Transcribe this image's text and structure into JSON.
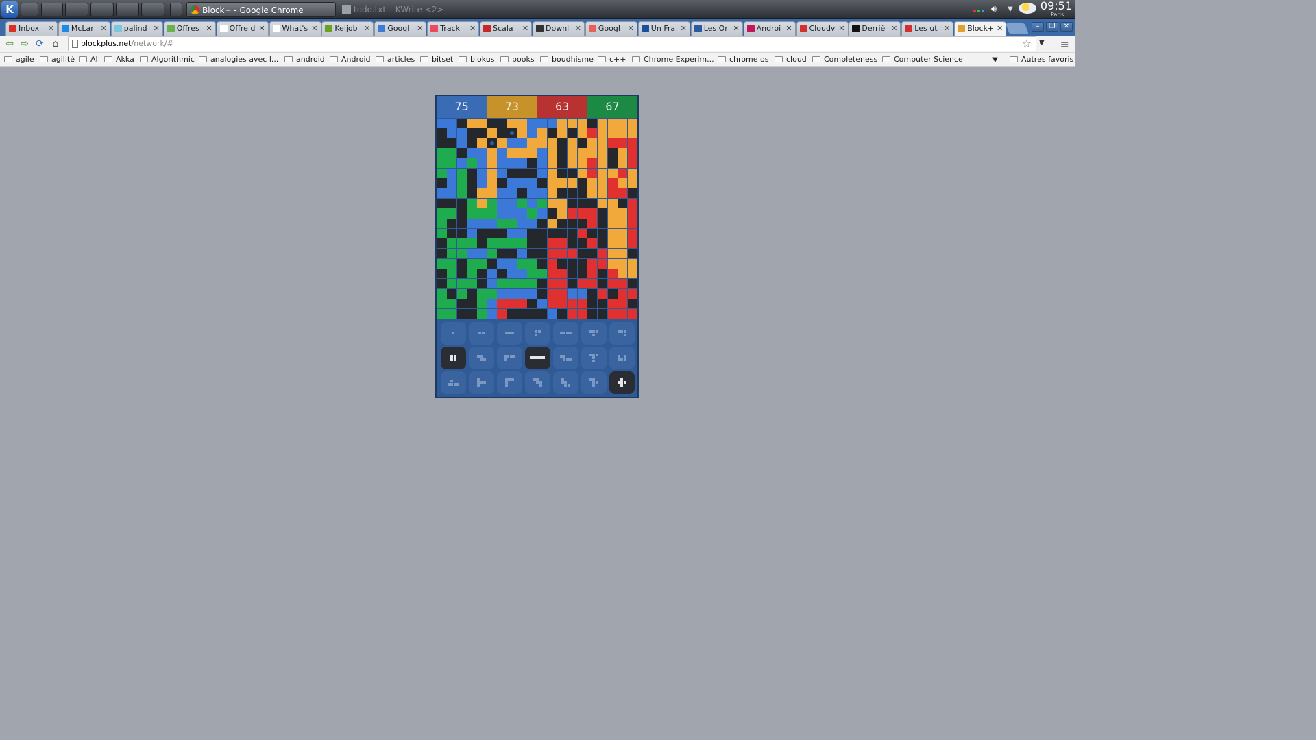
{
  "taskbar": {
    "tasks": [
      {
        "label": "Block+ - Google Chrome",
        "state": "active"
      },
      {
        "label": "todo.txt – KWrite <2>",
        "state": "inactive"
      }
    ],
    "clock": "09:51",
    "city": "Paris"
  },
  "tabs": [
    {
      "label": "Inbox",
      "icon": "gmail-icon",
      "color": "#d93025"
    },
    {
      "label": "McLar",
      "icon": "drive-icon",
      "color": "#1e88e5"
    },
    {
      "label": "palind",
      "icon": "docs-icon",
      "color": "#7ec6e0"
    },
    {
      "label": "Offres",
      "icon": "offres-icon",
      "color": "#6ab04c"
    },
    {
      "label": "Offre d",
      "icon": "page-icon",
      "color": "#ffffff"
    },
    {
      "label": "What's",
      "icon": "page-icon",
      "color": "#ffffff"
    },
    {
      "label": "Keljob",
      "icon": "keljob-icon",
      "color": "#6aa121"
    },
    {
      "label": "Googl",
      "icon": "calendar-icon",
      "color": "#3e7bd6"
    },
    {
      "label": "Track",
      "icon": "track-icon",
      "color": "#e84a5f"
    },
    {
      "label": "Scala",
      "icon": "scala-icon",
      "color": "#c62828"
    },
    {
      "label": "Downl",
      "icon": "download-icon",
      "color": "#333333"
    },
    {
      "label": "Googl",
      "icon": "google-icon",
      "color": "#e9605a"
    },
    {
      "label": "Un Fra",
      "icon": "unfra-icon",
      "color": "#1b4f9c"
    },
    {
      "label": "Les Or",
      "icon": "flag-icon",
      "color": "#2c5aa0"
    },
    {
      "label": "Androi",
      "icon": "android-icon",
      "color": "#c2185b"
    },
    {
      "label": "Cloudv",
      "icon": "cloud-icon",
      "color": "#d32f2f"
    },
    {
      "label": "Derriè",
      "icon": "derriere-icon",
      "color": "#111111"
    },
    {
      "label": "Les ut",
      "icon": "01net-icon",
      "color": "#d32f2f"
    },
    {
      "label": "Block+",
      "icon": "blockplus-icon",
      "color": "#e0a030"
    }
  ],
  "toolbar": {
    "url_host": "blockplus.net",
    "url_path": "/network/#"
  },
  "bookmarks": [
    "agile",
    "agilité",
    "AI",
    "Akka",
    "Algorithmic",
    "analogies avec l...",
    "android",
    "Android",
    "articles",
    "bitset",
    "blokus",
    "books",
    "boudhisme",
    "c++",
    "Chrome Experim...",
    "chrome os",
    "cloud",
    "Completeness",
    "Computer Science"
  ],
  "other_bookmarks": "Autres favoris",
  "game": {
    "scores": [
      {
        "value": "75",
        "color": "#3a6cb5"
      },
      {
        "value": "73",
        "color": "#c8922b"
      },
      {
        "value": "63",
        "color": "#b83232"
      },
      {
        "value": "67",
        "color": "#1c8a45"
      }
    ],
    "palette": {
      "B": "#3b78d8",
      "Y": "#f2a93b",
      "R": "#e0302f",
      "G": "#1fac4f",
      "D": "#24272c"
    },
    "board": [
      "BBDYYDDYYBBBYYYDYYYY",
      "DBBDDYDDYBYDYDYRYYYY",
      "DDBDYDYBBYYYDYDYYRRR",
      "GGDBBYBYYYBYDYYYYDYR",
      "GGBGBYBBBDBYDYYRYDYR",
      "GBGDBYBDDDBYDDYRYYRY",
      "DBGDBYDBBBDYYYDYYRYY",
      "BBGDYYBBDBBYDDDYYRRD",
      "DDDGYGBBGBGYYDDDYYDR",
      "GGDGGGBBBGBDYRRRDYYR",
      "GDDBBBGGBBDYDDDRDYYR",
      "GDDBDDDBBDDDDDRDDYYR",
      "DGGGDGGGGDDRRDDRDYYR",
      "DGGBBGDDBDDRRRDDRYY",
      "GGDGGDBBGGDRDDDRRYYY",
      "DGDGDBDBBGGRRDDRDRYY",
      "DGGGDBGGGGDRRDRRDRRD",
      "GDGDGGBBBBDRRBBDRDRR",
      "GGDDGBRRRDBRRRRDDRR",
      "GGDDGBRDDDDBDRRDDRRR"
    ],
    "marks": [
      [
        1,
        7
      ],
      [
        2,
        5
      ]
    ],
    "pieces": [
      {
        "cells": [
          [
            0,
            0
          ]
        ],
        "available": false
      },
      {
        "cells": [
          [
            0,
            0
          ],
          [
            1,
            0
          ]
        ],
        "available": false
      },
      {
        "cells": [
          [
            0,
            0
          ],
          [
            1,
            0
          ],
          [
            2,
            0
          ]
        ],
        "available": false
      },
      {
        "cells": [
          [
            0,
            0
          ],
          [
            1,
            0
          ],
          [
            0,
            1
          ]
        ],
        "available": false
      },
      {
        "cells": [
          [
            0,
            0
          ],
          [
            1,
            0
          ],
          [
            2,
            0
          ],
          [
            3,
            0
          ]
        ],
        "available": false
      },
      {
        "cells": [
          [
            0,
            0
          ],
          [
            1,
            0
          ],
          [
            2,
            0
          ],
          [
            1,
            1
          ]
        ],
        "available": false
      },
      {
        "cells": [
          [
            0,
            0
          ],
          [
            1,
            0
          ],
          [
            2,
            0
          ],
          [
            2,
            1
          ]
        ],
        "available": false
      },
      {
        "cells": [
          [
            0,
            0
          ],
          [
            1,
            0
          ],
          [
            0,
            1
          ],
          [
            1,
            1
          ]
        ],
        "available": true
      },
      {
        "cells": [
          [
            0,
            0
          ],
          [
            1,
            0
          ],
          [
            1,
            1
          ],
          [
            2,
            1
          ]
        ],
        "available": false
      },
      {
        "cells": [
          [
            0,
            0
          ],
          [
            1,
            0
          ],
          [
            2,
            0
          ],
          [
            3,
            0
          ],
          [
            0,
            1
          ]
        ],
        "available": false
      },
      {
        "cells": [
          [
            0,
            0
          ],
          [
            1,
            0
          ],
          [
            2,
            0
          ],
          [
            3,
            0
          ],
          [
            4,
            0
          ]
        ],
        "available": true
      },
      {
        "cells": [
          [
            0,
            0
          ],
          [
            1,
            0
          ],
          [
            2,
            1
          ],
          [
            1,
            1
          ],
          [
            3,
            1
          ]
        ],
        "available": false
      },
      {
        "cells": [
          [
            0,
            0
          ],
          [
            1,
            0
          ],
          [
            2,
            0
          ],
          [
            1,
            1
          ],
          [
            1,
            2
          ]
        ],
        "available": false
      },
      {
        "cells": [
          [
            0,
            0
          ],
          [
            2,
            0
          ],
          [
            0,
            1
          ],
          [
            1,
            1
          ],
          [
            2,
            1
          ]
        ],
        "available": false
      },
      {
        "cells": [
          [
            1,
            0
          ],
          [
            0,
            1
          ],
          [
            1,
            1
          ],
          [
            2,
            1
          ],
          [
            3,
            1
          ]
        ],
        "available": false
      },
      {
        "cells": [
          [
            0,
            0
          ],
          [
            0,
            1
          ],
          [
            1,
            1
          ],
          [
            2,
            1
          ],
          [
            0,
            2
          ]
        ],
        "available": false
      },
      {
        "cells": [
          [
            0,
            0
          ],
          [
            1,
            0
          ],
          [
            2,
            0
          ],
          [
            0,
            1
          ],
          [
            0,
            2
          ]
        ],
        "available": false
      },
      {
        "cells": [
          [
            0,
            0
          ],
          [
            1,
            0
          ],
          [
            1,
            1
          ],
          [
            2,
            1
          ],
          [
            2,
            2
          ]
        ],
        "available": false
      },
      {
        "cells": [
          [
            0,
            0
          ],
          [
            0,
            1
          ],
          [
            1,
            1
          ],
          [
            1,
            2
          ],
          [
            2,
            2
          ]
        ],
        "available": false
      },
      {
        "cells": [
          [
            0,
            0
          ],
          [
            1,
            0
          ],
          [
            1,
            1
          ],
          [
            2,
            1
          ],
          [
            1,
            2
          ]
        ],
        "available": false
      },
      {
        "cells": [
          [
            1,
            0
          ],
          [
            0,
            1
          ],
          [
            1,
            1
          ],
          [
            2,
            1
          ],
          [
            1,
            2
          ]
        ],
        "available": true
      }
    ]
  }
}
